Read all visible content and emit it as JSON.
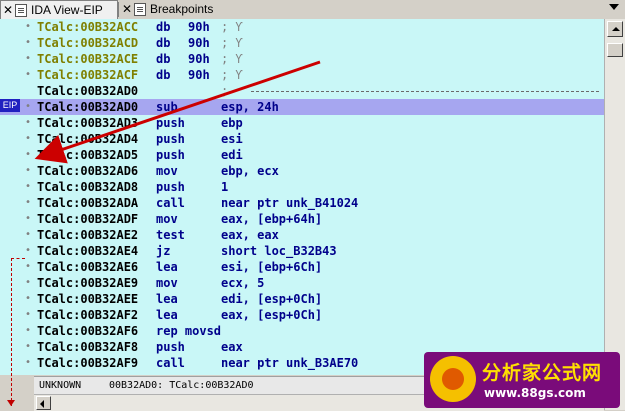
{
  "tabs": [
    {
      "label": "IDA View-EIP",
      "active": true
    },
    {
      "label": "Breakpoints",
      "active": false
    }
  ],
  "lines": [
    {
      "addr": "TCalc:00B32ACC",
      "mn": "db",
      "op": "90h",
      "cm": "; Ƴ",
      "style": "y"
    },
    {
      "addr": "TCalc:00B32ACD",
      "mn": "db",
      "op": "90h",
      "cm": "; Ƴ",
      "style": "y"
    },
    {
      "addr": "TCalc:00B32ACE",
      "mn": "db",
      "op": "90h",
      "cm": "; Ƴ",
      "style": "y"
    },
    {
      "addr": "TCalc:00B32ACF",
      "mn": "db",
      "op": "90h",
      "cm": "; Ƴ",
      "style": "y"
    },
    {
      "addr": "TCalc:00B32AD0",
      "mn": ";",
      "op": "",
      "cm": "",
      "style": "k",
      "separator": true
    },
    {
      "addr": "TCalc:00B32AD0",
      "mn": "sub",
      "op": "esp, 24h",
      "cm": "",
      "style": "k",
      "highlight": true
    },
    {
      "addr": "TCalc:00B32AD3",
      "mn": "push",
      "op": "ebp",
      "cm": "",
      "style": "k"
    },
    {
      "addr": "TCalc:00B32AD4",
      "mn": "push",
      "op": "esi",
      "cm": "",
      "style": "k"
    },
    {
      "addr": "TCalc:00B32AD5",
      "mn": "push",
      "op": "edi",
      "cm": "",
      "style": "k"
    },
    {
      "addr": "TCalc:00B32AD6",
      "mn": "mov",
      "op": "ebp, ecx",
      "cm": "",
      "style": "k"
    },
    {
      "addr": "TCalc:00B32AD8",
      "mn": "push",
      "op": "1",
      "cm": "",
      "style": "k"
    },
    {
      "addr": "TCalc:00B32ADA",
      "mn": "call",
      "op": "near ptr unk_B41024",
      "cm": "",
      "style": "k"
    },
    {
      "addr": "TCalc:00B32ADF",
      "mn": "mov",
      "op": "eax, [ebp+64h]",
      "cm": "",
      "style": "k"
    },
    {
      "addr": "TCalc:00B32AE2",
      "mn": "test",
      "op": "eax, eax",
      "cm": "",
      "style": "k"
    },
    {
      "addr": "TCalc:00B32AE4",
      "mn": "jz",
      "op": "short loc_B32B43",
      "cm": "",
      "style": "k"
    },
    {
      "addr": "TCalc:00B32AE6",
      "mn": "lea",
      "op": "esi, [ebp+6Ch]",
      "cm": "",
      "style": "k"
    },
    {
      "addr": "TCalc:00B32AE9",
      "mn": "mov",
      "op": "ecx, 5",
      "cm": "",
      "style": "k"
    },
    {
      "addr": "TCalc:00B32AEE",
      "mn": "lea",
      "op": "edi, [esp+0Ch]",
      "cm": "",
      "style": "k"
    },
    {
      "addr": "TCalc:00B32AF2",
      "mn": "lea",
      "op": "eax, [esp+0Ch]",
      "cm": "",
      "style": "k"
    },
    {
      "addr": "TCalc:00B32AF6",
      "mn": "rep movsd",
      "op": "",
      "cm": "",
      "style": "k"
    },
    {
      "addr": "TCalc:00B32AF8",
      "mn": "push",
      "op": "eax",
      "cm": "",
      "style": "k"
    },
    {
      "addr": "TCalc:00B32AF9",
      "mn": "call",
      "op": "near ptr unk_B3AE70",
      "cm": "",
      "style": "k"
    }
  ],
  "eip_label": "EIP",
  "status": {
    "mode": "UNKNOWN",
    "position": "00B32AD0: TCalc:00B32AD0"
  },
  "watermark": {
    "title": "分析家公式网",
    "url": "www.88gs.com"
  },
  "colors": {
    "background": "#c9f7f7",
    "highlight": "#a6a6f0",
    "arrow": "#cc0000"
  }
}
